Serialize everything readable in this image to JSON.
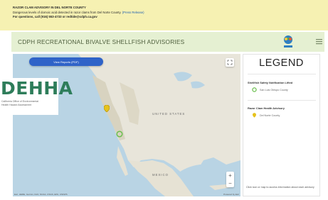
{
  "banner": {
    "line1": "RAZOR CLAM ADVISORY IN DEL NORTE COUNTY",
    "line2_text": "Dangerous levels of domoic acid detected in razor clams from Del Norte County.",
    "line2_link": "(Press Release)",
    "line3": "For questions, call (916) 553-4733 or redtide@cdph.ca.gov"
  },
  "titlebar": {
    "title": "CDPH RECREATIONAL BIVALVE SHELLFISH ADVISORIES",
    "logo_icon": "ca-shellfish-logo",
    "menu_icon": "menu-icon"
  },
  "map": {
    "report_button": "View Reports (PDF)",
    "region_label": "UNITED STATES",
    "country_label": "MEXICO",
    "attribution": "Esri, HERE, Garmin, FAO, NOAA, USGS, EPA, USFWS",
    "credit": "Powered by Esri",
    "zoom_in": "+",
    "zoom_out": "−",
    "water_color": "#b9d4e4",
    "land_color": "#e8e5da"
  },
  "dehha": {
    "word": "DEHHA",
    "tagline1": "California Office of Environmental",
    "tagline2": "Health Hazard Assessment"
  },
  "legend": {
    "title": "LEGEND",
    "section1": "Shellfish Safety Notification Lifted",
    "section1_item": "San Luis Obispo County",
    "section1_color": "#6bbf4e",
    "section2": "Razor Clam Health Advisory",
    "section2_item": "Del Norte County",
    "section2_color": "#e6c21c",
    "note": "Click icon or map to access information about each advisory"
  }
}
